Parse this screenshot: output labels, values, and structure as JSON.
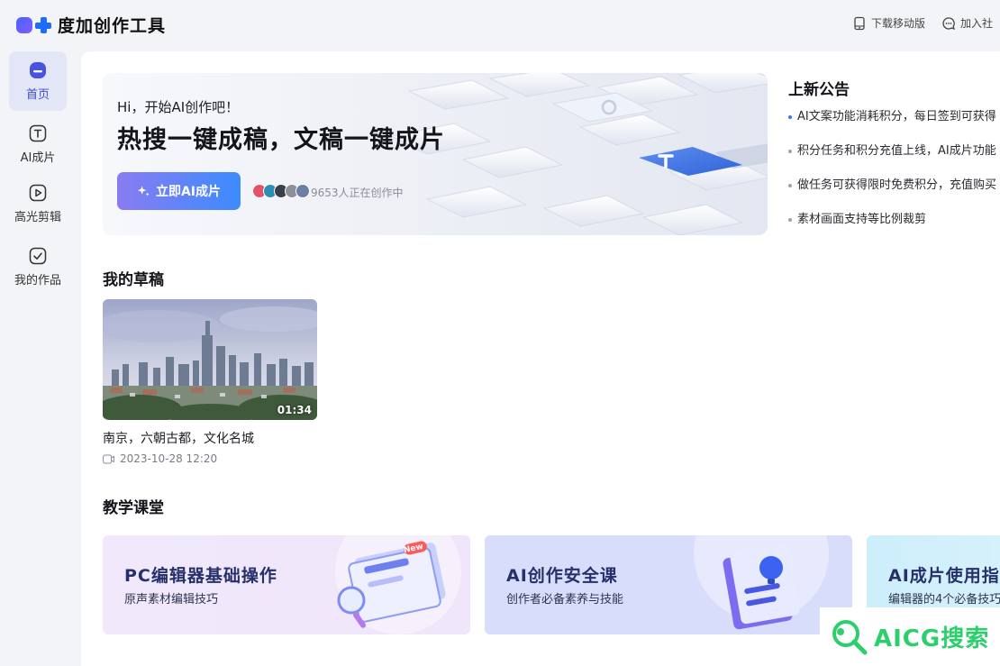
{
  "app": {
    "name": "度加创作工具"
  },
  "topbar": {
    "download_label": "下载移动版",
    "community_label": "加入社"
  },
  "sidebar": {
    "items": [
      {
        "label": "首页",
        "icon": "home-icon"
      },
      {
        "label": "AI成片",
        "icon": "text-t-icon"
      },
      {
        "label": "高光剪辑",
        "icon": "play-icon"
      },
      {
        "label": "我的作品",
        "icon": "checkbox-icon"
      }
    ]
  },
  "banner": {
    "greeting": "Hi，开始AI创作吧！",
    "title": "热搜一键成稿，文稿一键成片",
    "cta_label": "立即AI成片",
    "creating_text": "9653人正在创作中"
  },
  "notice": {
    "title": "上新公告",
    "items": [
      "AI文案功能消耗积分，每日签到可获得",
      "积分任务和积分充值上线，AI成片功能",
      "做任务可获得限时免费积分，充值购买",
      "素材画面支持等比例裁剪"
    ]
  },
  "drafts": {
    "title": "我的草稿",
    "items": [
      {
        "name": "南京，六朝古都，文化名城",
        "date": "2023-10-28 12:20",
        "duration": "01:34"
      }
    ]
  },
  "courses": {
    "title": "教学课堂",
    "items": [
      {
        "title": "PC编辑器基础操作",
        "subtitle": "原声素材编辑技巧",
        "badge": "New"
      },
      {
        "title": "AI创作安全课",
        "subtitle": "创作者必备素养与技能"
      },
      {
        "title": "AI成片使用指南",
        "subtitle": "编辑器的4个必备技巧"
      }
    ]
  },
  "watermark": {
    "text": "AICG搜索"
  },
  "colors": {
    "accent": "#3d4cd9",
    "cta_start": "#8a7cf2",
    "cta_end": "#3c8bff",
    "watermark": "#2dcf6d"
  }
}
